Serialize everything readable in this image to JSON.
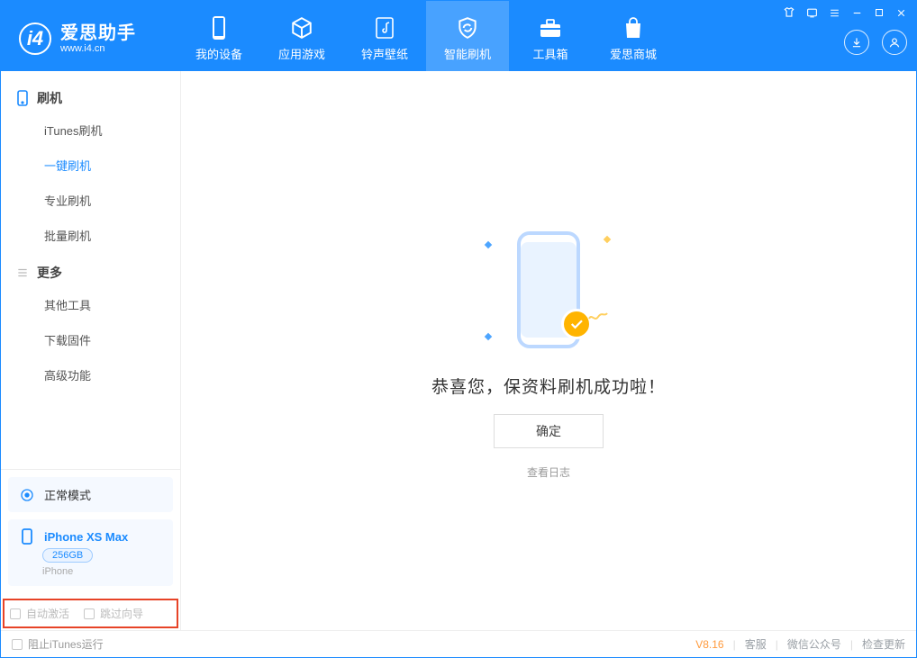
{
  "brand": {
    "cn": "爱思助手",
    "url": "www.i4.cn"
  },
  "nav": {
    "device": "我的设备",
    "apps": "应用游戏",
    "media": "铃声壁纸",
    "flash": "智能刷机",
    "toolbox": "工具箱",
    "store": "爱思商城"
  },
  "sidebar": {
    "group_flash": "刷机",
    "items_flash": {
      "itunes": "iTunes刷机",
      "onekey": "一键刷机",
      "pro": "专业刷机",
      "batch": "批量刷机"
    },
    "group_more": "更多",
    "items_more": {
      "other": "其他工具",
      "download": "下载固件",
      "adv": "高级功能"
    }
  },
  "device_panel": {
    "mode": "正常模式",
    "name": "iPhone XS Max",
    "capacity": "256GB",
    "sub": "iPhone"
  },
  "highlight": {
    "auto_activate": "自动激活",
    "skip_guide": "跳过向导"
  },
  "main": {
    "success": "恭喜您，保资料刷机成功啦！",
    "ok": "确定",
    "log": "查看日志"
  },
  "status": {
    "block_itunes": "阻止iTunes运行",
    "version": "V8.16",
    "service": "客服",
    "wechat": "微信公众号",
    "update": "检查更新"
  }
}
